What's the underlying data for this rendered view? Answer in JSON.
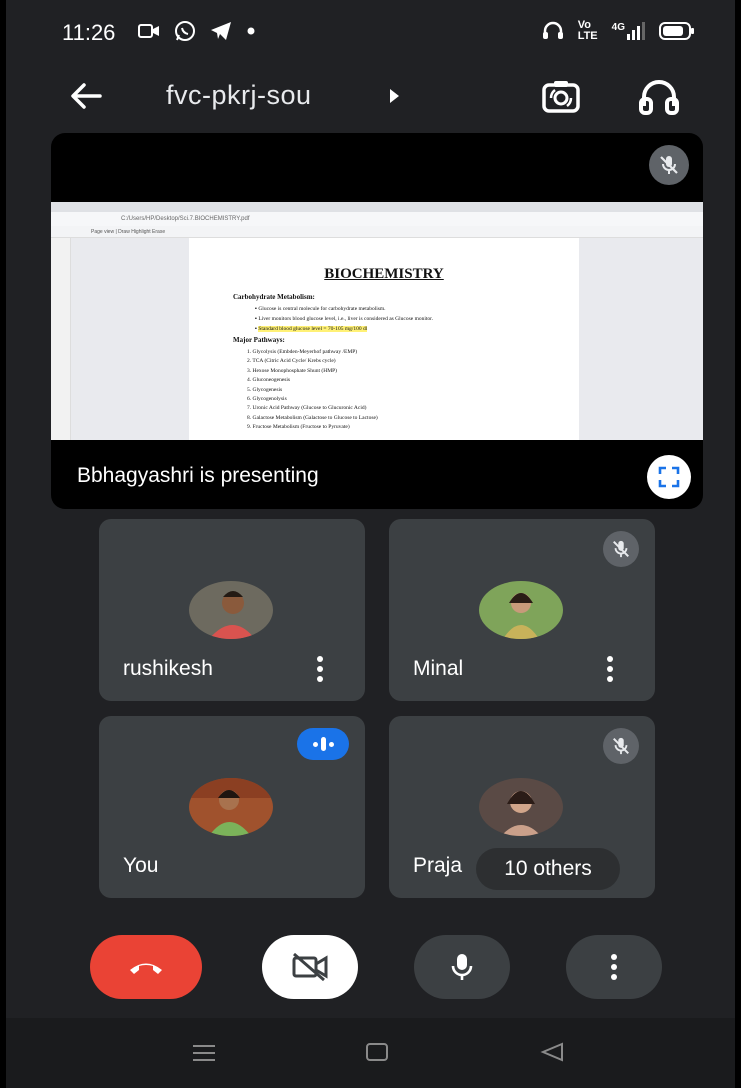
{
  "status_bar": {
    "time": "11:26",
    "network_top": "Vo",
    "network_bottom": "LTE",
    "signal_label": "4G"
  },
  "header": {
    "meeting_code": "fvc-pkrj-sou"
  },
  "presentation": {
    "presenter_label": "Bbhagyashri is presenting",
    "shared_document": {
      "address": "C:/Users/HP/Desktop/Sci.7.BIOCHEMISTRY.pdf",
      "toolbar": "Page view    |    Draw    Highlight    Erase",
      "title": "BIOCHEMISTRY",
      "heading1": "Carbohydrate Metabolism:",
      "bullets": [
        "Glucose is central molecule for carbohydrate metabolism.",
        "Liver monitors blood glucose level, i.e., liver is considered as Glucose monitor.",
        "Standard blood glucose level = 70-105 mg/100 dl"
      ],
      "heading2": "Major Pathways:",
      "pathways": [
        "1.  Glycolysis (Embden-Meyerhof pathway /EMP)",
        "2.  TCA (Citric Acid Cycle/ Krebs cycle)",
        "3.  Hexose Monophosphate Shunt (HMP)",
        "4.  Gluconeogenesis",
        "5.  Glycogenesis",
        "6.  Glycogenolysis",
        "7.  Uronic Acid Pathway (Glucose to Glucuronic Acid)",
        "8.  Galactose Metabolism (Galactose to Glucose to Lactose)",
        "9.  Fructose Metabolism (Fructose to Pyruvate)"
      ]
    }
  },
  "participants": [
    {
      "name": "rushikesh",
      "muted": false
    },
    {
      "name": "Minal",
      "muted": true
    },
    {
      "name": "You",
      "speaking": true
    },
    {
      "name": "Praja",
      "muted": true
    }
  ],
  "others_chip": "10 others",
  "controls": {
    "end_call_icon": "phone-hangup-icon",
    "camera_icon": "camera-off-icon",
    "mic_icon": "microphone-icon",
    "more_icon": "more-vert-icon"
  },
  "colors": {
    "background": "#202124",
    "tile": "#3c4043",
    "end_call": "#ea4335",
    "speaking": "#1a73e8"
  }
}
